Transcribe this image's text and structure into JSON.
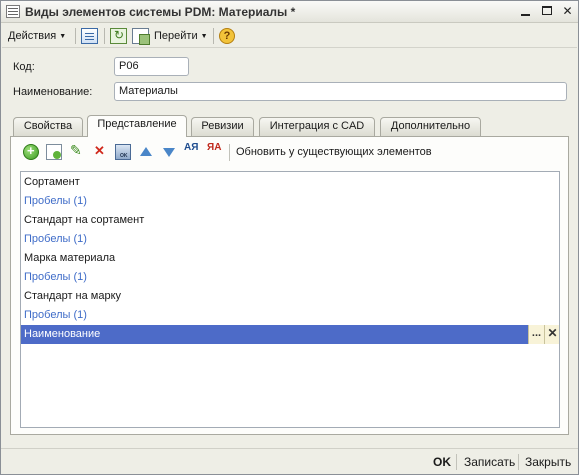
{
  "window": {
    "title": "Виды элементов системы PDM: Материалы *"
  },
  "toolbar": {
    "actions_label": "Действия",
    "goto_label": "Перейти",
    "help_label": "?"
  },
  "form": {
    "code_label": "Код:",
    "code_value": "P06",
    "name_label": "Наименование:",
    "name_value": "Материалы"
  },
  "tabs": [
    {
      "label": "Свойства",
      "active": false
    },
    {
      "label": "Представление",
      "active": true
    },
    {
      "label": "Ревизии",
      "active": false
    },
    {
      "label": "Интеграция с CAD",
      "active": false
    },
    {
      "label": "Дополнительно",
      "active": false
    }
  ],
  "panel": {
    "update_label": "Обновить у существующих элементов",
    "sort_asc_label": "АЯ",
    "sort_desc_label": "ЯА"
  },
  "list": {
    "rows": [
      {
        "text": "Сортамент",
        "kind": "plain"
      },
      {
        "text": "Пробелы (1)",
        "kind": "link"
      },
      {
        "text": "Стандарт на сортамент",
        "kind": "plain"
      },
      {
        "text": "Пробелы (1)",
        "kind": "link"
      },
      {
        "text": "Марка материала",
        "kind": "plain"
      },
      {
        "text": "Пробелы (1)",
        "kind": "link"
      },
      {
        "text": "Стандарт на марку",
        "kind": "plain"
      },
      {
        "text": "Пробелы (1)",
        "kind": "link"
      },
      {
        "text": "Наименование",
        "kind": "selected"
      }
    ],
    "row_dots": "...",
    "row_clear": "✕"
  },
  "footer": {
    "ok_label": "OK",
    "save_label": "Записать",
    "close_label": "Закрыть"
  },
  "colors": {
    "selection": "#4d6bc8",
    "link": "#3f6cc8",
    "delete": "#d0291c"
  }
}
